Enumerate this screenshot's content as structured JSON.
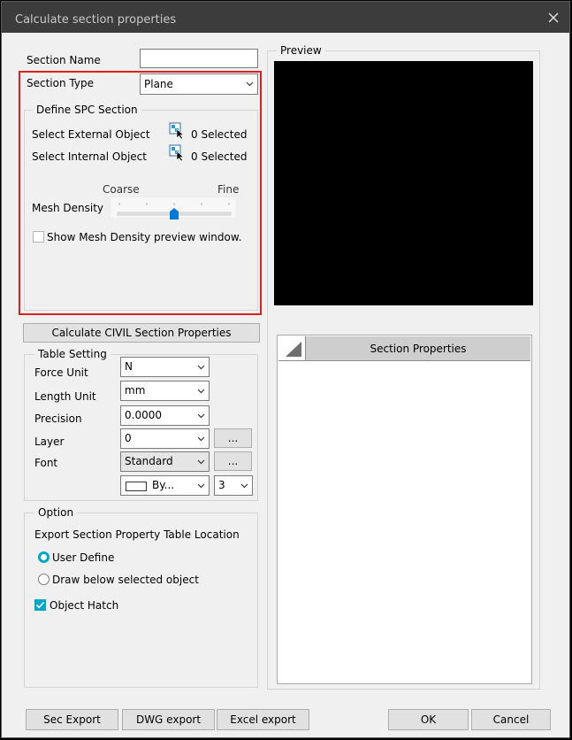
{
  "window": {
    "title": "Calculate section properties",
    "close_icon": "close-icon"
  },
  "section_name": {
    "label": "Section Name",
    "value": ""
  },
  "section_type": {
    "label": "Section Type",
    "value": "Plane"
  },
  "spc": {
    "legend": "Define SPC Section",
    "external_label": "Select External Object",
    "external_count": "0 Selected",
    "internal_label": "Select Internal Object",
    "internal_count": "0 Selected",
    "select_icon": "select-objects-icon",
    "mesh_coarse": "Coarse",
    "mesh_fine": "Fine",
    "mesh_label": "Mesh Density",
    "mesh_level": 0.5,
    "preview_checkbox": "Show Mesh Density preview window.",
    "preview_checked": false
  },
  "calculate_button": "Calculate CIVIL Section Properties",
  "table_setting": {
    "legend": "Table Setting",
    "force_label": "Force Unit",
    "force_value": "N",
    "length_label": "Length Unit",
    "length_value": "mm",
    "precision_label": "Precision",
    "precision_value": "0.0000",
    "layer_label": "Layer",
    "layer_value": "0",
    "layer_more": "...",
    "font_label": "Font",
    "font_value": "Standard",
    "font_more": "...",
    "color_value": "By...",
    "size_value": "3"
  },
  "option": {
    "legend": "Option",
    "export_label": "Export Section Property Table Location",
    "user_define": "User Define",
    "draw_below": "Draw below selected object",
    "selected_location": "User Define",
    "object_hatch": "Object Hatch",
    "object_hatch_checked": true
  },
  "preview": {
    "legend": "Preview"
  },
  "properties_table": {
    "header": "Section Properties"
  },
  "footer": {
    "sec_export": "Sec Export",
    "dwg_export": "DWG export",
    "excel_export": "Excel export",
    "ok": "OK",
    "cancel": "Cancel"
  },
  "colors": {
    "highlight_border": "#e02020",
    "accent": "#0078d7",
    "radio_on": "#00a7c7",
    "titlebar": "#3c3c3c"
  }
}
